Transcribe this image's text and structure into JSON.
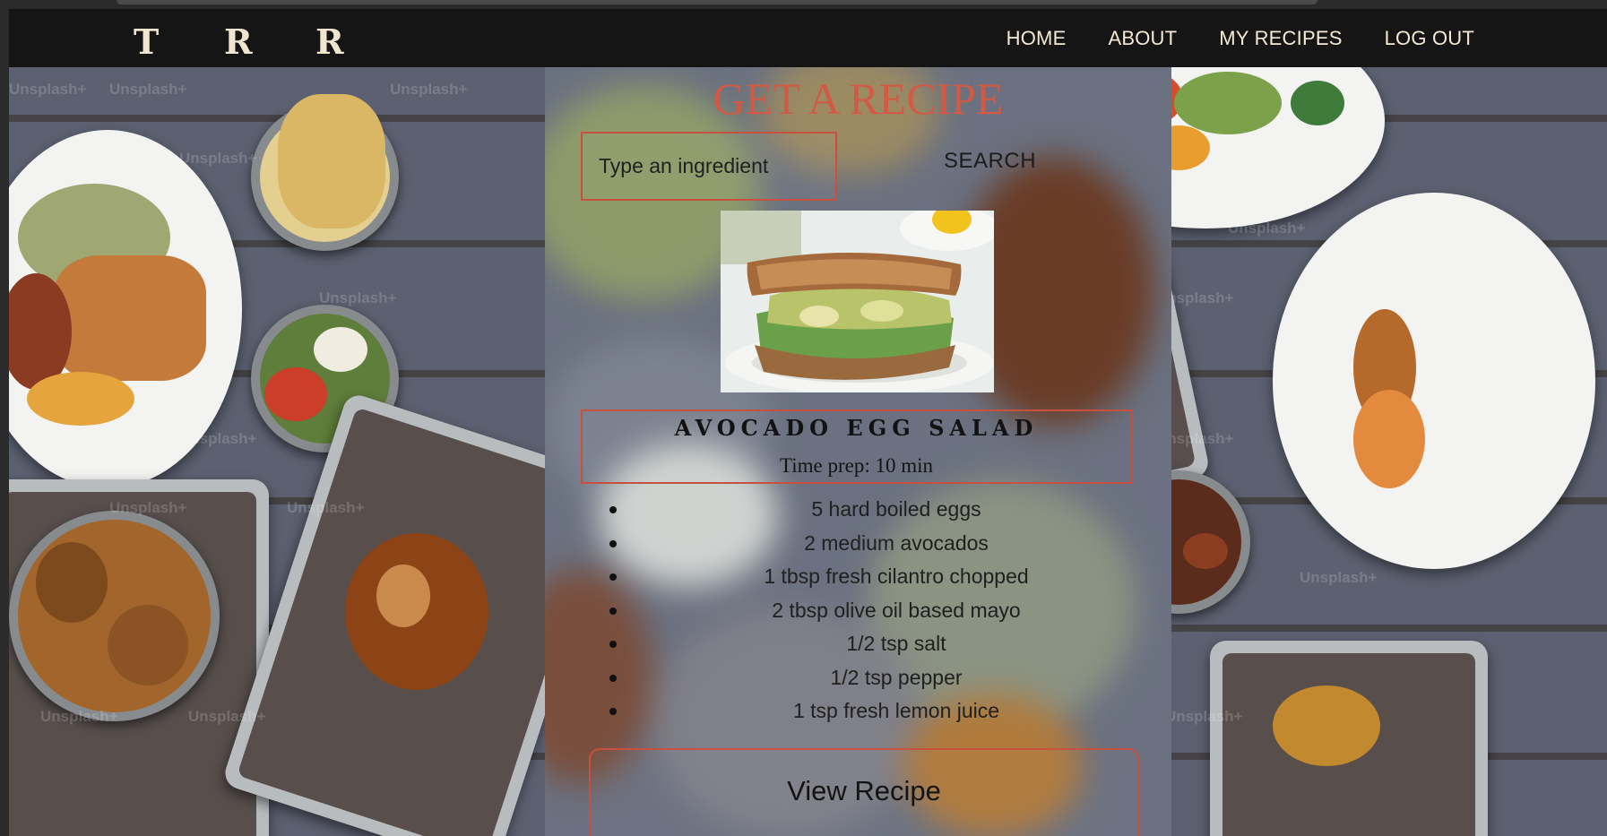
{
  "logo": {
    "letters": [
      "T",
      "R",
      "R"
    ]
  },
  "nav": {
    "items": [
      "HOME",
      "ABOUT",
      "MY RECIPES",
      "LOG OUT"
    ]
  },
  "watermark": "Unsplash+",
  "search": {
    "title": "GET A RECIPE",
    "placeholder": "Type an ingredient",
    "value": "",
    "button_label": "SEARCH"
  },
  "recipe": {
    "name": "AVOCADO EGG SALAD",
    "time_prep": "Time prep: 10 min",
    "ingredients": [
      "5 hard boiled eggs",
      "2 medium avocados",
      "1 tbsp fresh cilantro chopped",
      "2 tbsp olive oil based mayo",
      "1/2 tsp salt",
      "1/2 tsp pepper",
      "1 tsp fresh lemon juice"
    ],
    "view_label": "View Recipe"
  },
  "colors": {
    "accent": "#d25a44",
    "navbar": "#151515",
    "nav_text": "#f4ead6",
    "table": "#5c6070"
  }
}
